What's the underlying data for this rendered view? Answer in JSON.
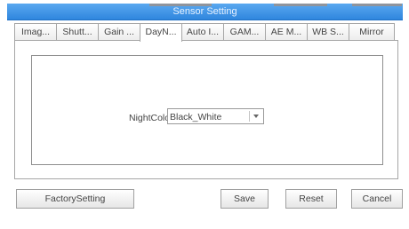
{
  "window": {
    "title": "Sensor Setting"
  },
  "tabs": [
    {
      "label": "Imag..."
    },
    {
      "label": "Shutt..."
    },
    {
      "label": "Gain ..."
    },
    {
      "label": "DayN...",
      "active": true
    },
    {
      "label": "Auto I..."
    },
    {
      "label": "GAM..."
    },
    {
      "label": "AE M..."
    },
    {
      "label": "WB S..."
    },
    {
      "label": "Mirror"
    }
  ],
  "daynight": {
    "night_color_label": "NightColor",
    "night_color_value": "Black_White"
  },
  "buttons": {
    "factory": "FactorySetting",
    "save": "Save",
    "reset": "Reset",
    "cancel": "Cancel"
  },
  "colors": {
    "titlebar": "#2f86de",
    "border": "#a6a6a6"
  }
}
